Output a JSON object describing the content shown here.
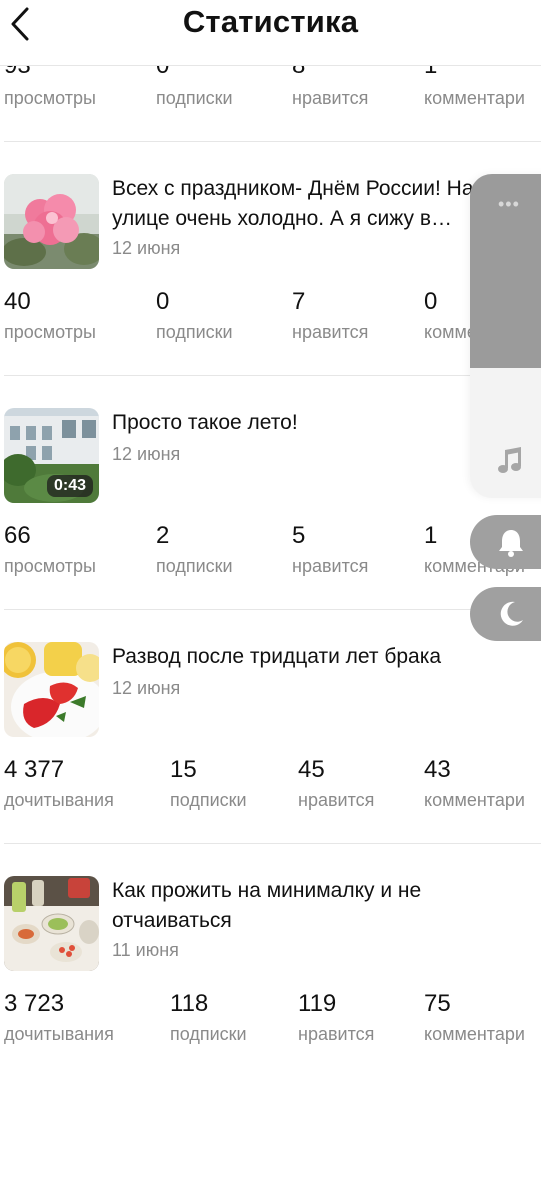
{
  "header": {
    "title": "Статистика",
    "back_icon": "chevron-left-icon"
  },
  "partial_stats": [
    {
      "value": "93",
      "label": "просмотры"
    },
    {
      "value": "0",
      "label": "подписки"
    },
    {
      "value": "8",
      "label": "нравится"
    },
    {
      "value": "1",
      "label": "комментари"
    }
  ],
  "posts": [
    {
      "title": "Всех с праздником- Днём России! На улице очень холодно. А я сижу в…",
      "date": "12 июня",
      "thumb": "pink-flower",
      "stats": [
        {
          "value": "40",
          "label": "просмотры"
        },
        {
          "value": "0",
          "label": "подписки"
        },
        {
          "value": "7",
          "label": "нравится"
        },
        {
          "value": "0",
          "label": "комментари"
        }
      ]
    },
    {
      "title": "Просто такое лето!",
      "date": "12 июня",
      "thumb": "building-video",
      "duration": "0:43",
      "stats": [
        {
          "value": "66",
          "label": "просмотры"
        },
        {
          "value": "2",
          "label": "подписки"
        },
        {
          "value": "5",
          "label": "нравится"
        },
        {
          "value": "1",
          "label": "комментари"
        }
      ]
    },
    {
      "title": "Развод после тридцати лет брака",
      "date": "12 июня",
      "thumb": "fruit-plate",
      "stats": [
        {
          "value": "4 377",
          "label": "дочитывания"
        },
        {
          "value": "15",
          "label": "подписки"
        },
        {
          "value": "45",
          "label": "нравится"
        },
        {
          "value": "43",
          "label": "комментари"
        }
      ]
    },
    {
      "title": "Как прожить на минималку и не отчаиваться",
      "date": "11 июня",
      "thumb": "dinner-table",
      "stats": [
        {
          "value": "3 723",
          "label": "дочитывания"
        },
        {
          "value": "118",
          "label": "подписки"
        },
        {
          "value": "119",
          "label": "нравится"
        },
        {
          "value": "75",
          "label": "комментари"
        }
      ]
    }
  ],
  "side_panel": {
    "more_icon": "more-dots-icon",
    "more_label": "•••",
    "music_icon": "music-note-icon",
    "bell_icon": "bell-icon",
    "moon_icon": "moon-icon"
  },
  "colors": {
    "muted": "#8a8a8a",
    "separator": "#e6e6e6",
    "panel_gray": "#9b9b9b"
  }
}
